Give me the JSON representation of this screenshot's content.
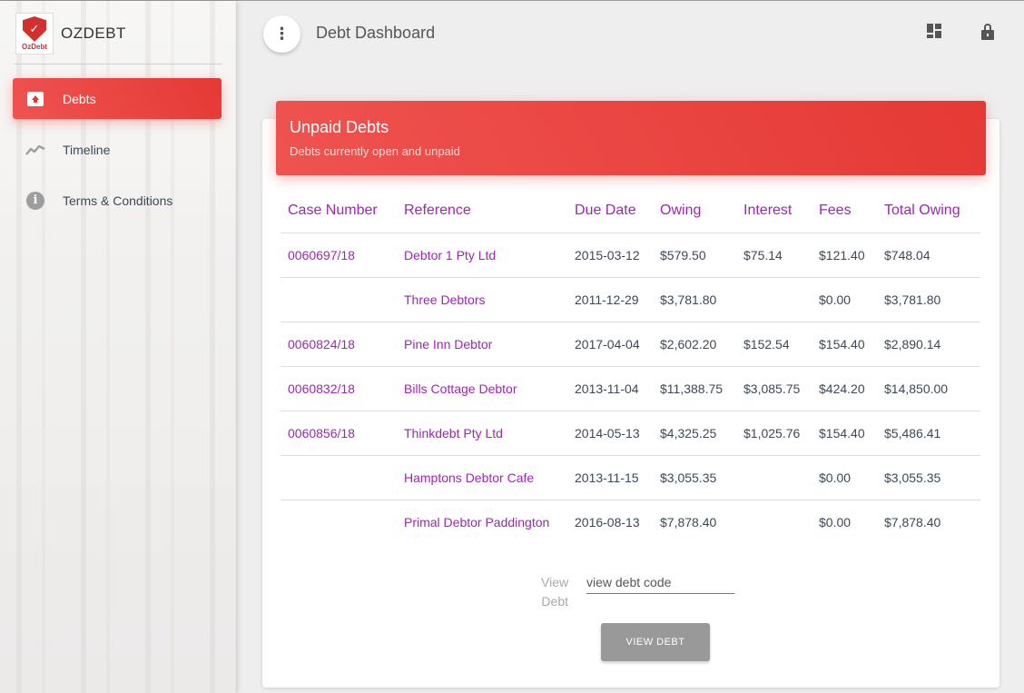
{
  "brand": {
    "name": "OZDEBT",
    "logo_text": "OzDebt"
  },
  "sidebar": {
    "items": [
      {
        "label": "Debts",
        "icon": "debts-icon",
        "active": true
      },
      {
        "label": "Timeline",
        "icon": "timeline-icon",
        "active": false
      },
      {
        "label": "Terms & Conditions",
        "icon": "info-icon",
        "active": false
      }
    ]
  },
  "header": {
    "title": "Debt Dashboard",
    "menu_icon": "more-vert-icon",
    "icons": [
      "dashboard-icon",
      "lock-icon"
    ]
  },
  "card": {
    "title": "Unpaid Debts",
    "category": "Debts currently open and unpaid",
    "columns": [
      "Case Number",
      "Reference",
      "Due Date",
      "Owing",
      "Interest",
      "Fees",
      "Total Owing"
    ],
    "rows": [
      [
        "0060697/18",
        "Debtor 1 Pty Ltd",
        "2015-03-12",
        "$579.50",
        "$75.14",
        "$121.40",
        "$748.04"
      ],
      [
        "",
        "Three Debtors",
        "2011-12-29",
        "$3,781.80",
        "",
        "$0.00",
        "$3,781.80"
      ],
      [
        "0060824/18",
        "Pine Inn Debtor",
        "2017-04-04",
        "$2,602.20",
        "$152.54",
        "$154.40",
        "$2,890.14"
      ],
      [
        "0060832/18",
        "Bills Cottage Debtor",
        "2013-11-04",
        "$11,388.75",
        "$3,085.75",
        "$424.20",
        "$14,850.00"
      ],
      [
        "0060856/18",
        "Thinkdebt Pty Ltd",
        "2014-05-13",
        "$4,325.25",
        "$1,025.76",
        "$154.40",
        "$5,486.41"
      ],
      [
        "",
        "Hamptons Debtor Cafe",
        "2013-11-15",
        "$3,055.35",
        "",
        "$0.00",
        "$3,055.35"
      ],
      [
        "",
        "Primal Debtor Paddington",
        "2016-08-13",
        "$7,878.40",
        "",
        "$0.00",
        "$7,878.40"
      ]
    ]
  },
  "view_debt": {
    "label": "View Debt",
    "placeholder": "view debt code",
    "button_label": "VIEW DEBT"
  },
  "colors": {
    "accent": "#e53935",
    "link": "#9c27b0",
    "button": "#999999"
  }
}
